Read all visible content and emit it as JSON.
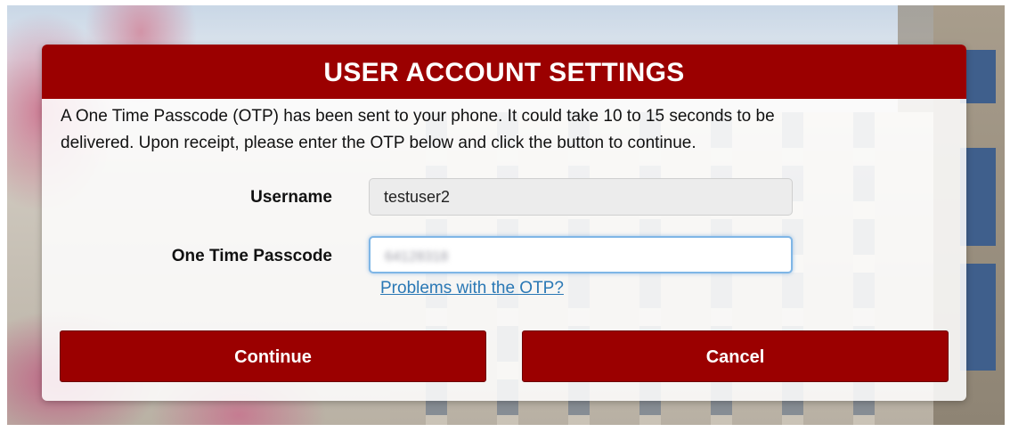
{
  "dialog": {
    "title": "USER ACCOUNT SETTINGS",
    "intro_line1": "A One Time Passcode (OTP) has been sent to your phone. It could take 10 to 15 seconds to be",
    "intro_line2": "delivered. Upon receipt, please enter the OTP below and click the button to continue."
  },
  "form": {
    "username_label": "Username",
    "username_value": "testuser2",
    "otp_label": "One Time Passcode",
    "otp_value": "64128318",
    "otp_help_link": "Problems with the OTP?"
  },
  "buttons": {
    "continue_label": "Continue",
    "cancel_label": "Cancel"
  },
  "colors": {
    "brand_red": "#9b0000",
    "link_blue": "#2a78b5"
  }
}
